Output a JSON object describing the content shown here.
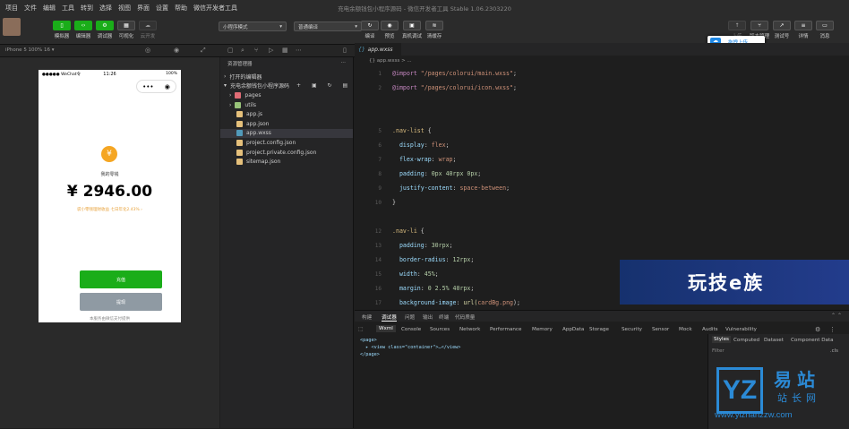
{
  "window": {
    "title": "充电余额钱包小程序源码 - 微信开发者工具 Stable 1.06.2303220"
  },
  "menu": [
    "项目",
    "文件",
    "编辑",
    "工具",
    "转到",
    "选择",
    "视图",
    "界面",
    "设置",
    "帮助",
    "微信开发者工具"
  ],
  "toolbar": {
    "left": [
      "模拟器",
      "编辑器",
      "调试器",
      "可视化",
      "云开发"
    ],
    "mode_select": "小程序模式",
    "compile_select": "普通编译",
    "mid": [
      "编译",
      "预览",
      "真机调试",
      "清缓存"
    ],
    "right": [
      "上传",
      "版本管理",
      "测试号",
      "详情",
      "消息"
    ],
    "upload_tip": "拖拽上传"
  },
  "subbar": {
    "device": "iPhone 5 100% 16 ▾"
  },
  "phone": {
    "carrier": "●●●●● WeChat令",
    "time": "11:26",
    "battery": "100%",
    "coin": "¥",
    "balance_label": "我的零钱",
    "balance": "¥ 2946.00",
    "note": "袋小零钱理财收益 七日年化2.43% ›",
    "btn_primary": "充值",
    "btn_secondary": "提现",
    "footer": "本服务由微信支付提供"
  },
  "explorer": {
    "title": "资源管理器",
    "section_open": "打开的编辑器",
    "section_project": "充电余额钱包小程序源码",
    "files": [
      {
        "name": "pages",
        "type": "folder-red"
      },
      {
        "name": "utils",
        "type": "folder-green"
      },
      {
        "name": "app.js",
        "type": "js"
      },
      {
        "name": "app.json",
        "type": "json"
      },
      {
        "name": "app.wxss",
        "type": "wxss"
      },
      {
        "name": "project.config.json",
        "type": "json"
      },
      {
        "name": "project.private.config.json",
        "type": "json"
      },
      {
        "name": "sitemap.json",
        "type": "json"
      }
    ]
  },
  "editor": {
    "tab": "app.wxss",
    "breadcrumb": "{} app.wxss > ...",
    "line_numbers": [
      "1",
      "2",
      "",
      "",
      "5",
      "6",
      "7",
      "8",
      "9",
      "10",
      "11",
      "12",
      "13",
      "14",
      "15",
      "16",
      "17",
      "18"
    ],
    "lines": [
      [
        {
          "t": "@import ",
          "c": "#c586c0"
        },
        {
          "t": "\"/pages/colorui/main.wxss\"",
          "c": "#ce9178"
        },
        {
          "t": ";",
          "c": "#ccc"
        }
      ],
      [
        {
          "t": "@import ",
          "c": "#c586c0"
        },
        {
          "t": "\"/pages/colorui/icon.wxss\"",
          "c": "#ce9178"
        },
        {
          "t": ";",
          "c": "#ccc"
        }
      ],
      [],
      [],
      [
        {
          "t": ".nav-list ",
          "c": "#d7ba7d"
        },
        {
          "t": "{",
          "c": "#ccc"
        }
      ],
      [
        {
          "t": "  display",
          "c": "#9cdcfe"
        },
        {
          "t": ": ",
          "c": "#ccc"
        },
        {
          "t": "flex",
          "c": "#ce9178"
        },
        {
          "t": ";",
          "c": "#ccc"
        }
      ],
      [
        {
          "t": "  flex-wrap",
          "c": "#9cdcfe"
        },
        {
          "t": ": ",
          "c": "#ccc"
        },
        {
          "t": "wrap",
          "c": "#ce9178"
        },
        {
          "t": ";",
          "c": "#ccc"
        }
      ],
      [
        {
          "t": "  padding",
          "c": "#9cdcfe"
        },
        {
          "t": ": ",
          "c": "#ccc"
        },
        {
          "t": "0px 40rpx 0px",
          "c": "#b5cea8"
        },
        {
          "t": ";",
          "c": "#ccc"
        }
      ],
      [
        {
          "t": "  justify-content",
          "c": "#9cdcfe"
        },
        {
          "t": ": ",
          "c": "#ccc"
        },
        {
          "t": "space-between",
          "c": "#ce9178"
        },
        {
          "t": ";",
          "c": "#ccc"
        }
      ],
      [
        {
          "t": "}",
          "c": "#ccc"
        }
      ],
      [],
      [
        {
          "t": ".nav-li ",
          "c": "#d7ba7d"
        },
        {
          "t": "{",
          "c": "#ccc"
        }
      ],
      [
        {
          "t": "  padding",
          "c": "#9cdcfe"
        },
        {
          "t": ": ",
          "c": "#ccc"
        },
        {
          "t": "30rpx",
          "c": "#b5cea8"
        },
        {
          "t": ";",
          "c": "#ccc"
        }
      ],
      [
        {
          "t": "  border-radius",
          "c": "#9cdcfe"
        },
        {
          "t": ": ",
          "c": "#ccc"
        },
        {
          "t": "12rpx",
          "c": "#b5cea8"
        },
        {
          "t": ";",
          "c": "#ccc"
        }
      ],
      [
        {
          "t": "  width",
          "c": "#9cdcfe"
        },
        {
          "t": ": ",
          "c": "#ccc"
        },
        {
          "t": "45%",
          "c": "#b5cea8"
        },
        {
          "t": ";",
          "c": "#ccc"
        }
      ],
      [
        {
          "t": "  margin",
          "c": "#9cdcfe"
        },
        {
          "t": ": ",
          "c": "#ccc"
        },
        {
          "t": "0 2.5% 40rpx",
          "c": "#b5cea8"
        },
        {
          "t": ";",
          "c": "#ccc"
        }
      ],
      [
        {
          "t": "  background-image",
          "c": "#9cdcfe"
        },
        {
          "t": ": ",
          "c": "#ccc"
        },
        {
          "t": "url(",
          "c": "#dcdcaa"
        },
        {
          "t": "cardBg.png",
          "c": "#ce9178"
        },
        {
          "t": ");",
          "c": "#ccc"
        }
      ]
    ]
  },
  "watermark1": "玩技e族",
  "debug": {
    "tabs": [
      "构建",
      "调试器",
      "问题",
      "输出",
      "终端",
      "代码质量"
    ],
    "devtabs": [
      "Wxml",
      "Console",
      "Sources",
      "Network",
      "Performance",
      "Memory",
      "AppData",
      "Storage",
      "Security",
      "Sensor",
      "Mock",
      "Audits",
      "Vulnerability"
    ],
    "styletabs": [
      "Styles",
      "Computed",
      "Dataset",
      "Component Data"
    ],
    "filter": "Filter",
    "cls": ".cls",
    "wxml": [
      "<page>",
      "  ▸ <view class=\"container\">…</view>",
      "</page>"
    ]
  },
  "watermark2": {
    "big": "YZ",
    "cn1": "易站",
    "cn2": "站长网",
    "url": "www.yizhanzzw.com"
  }
}
